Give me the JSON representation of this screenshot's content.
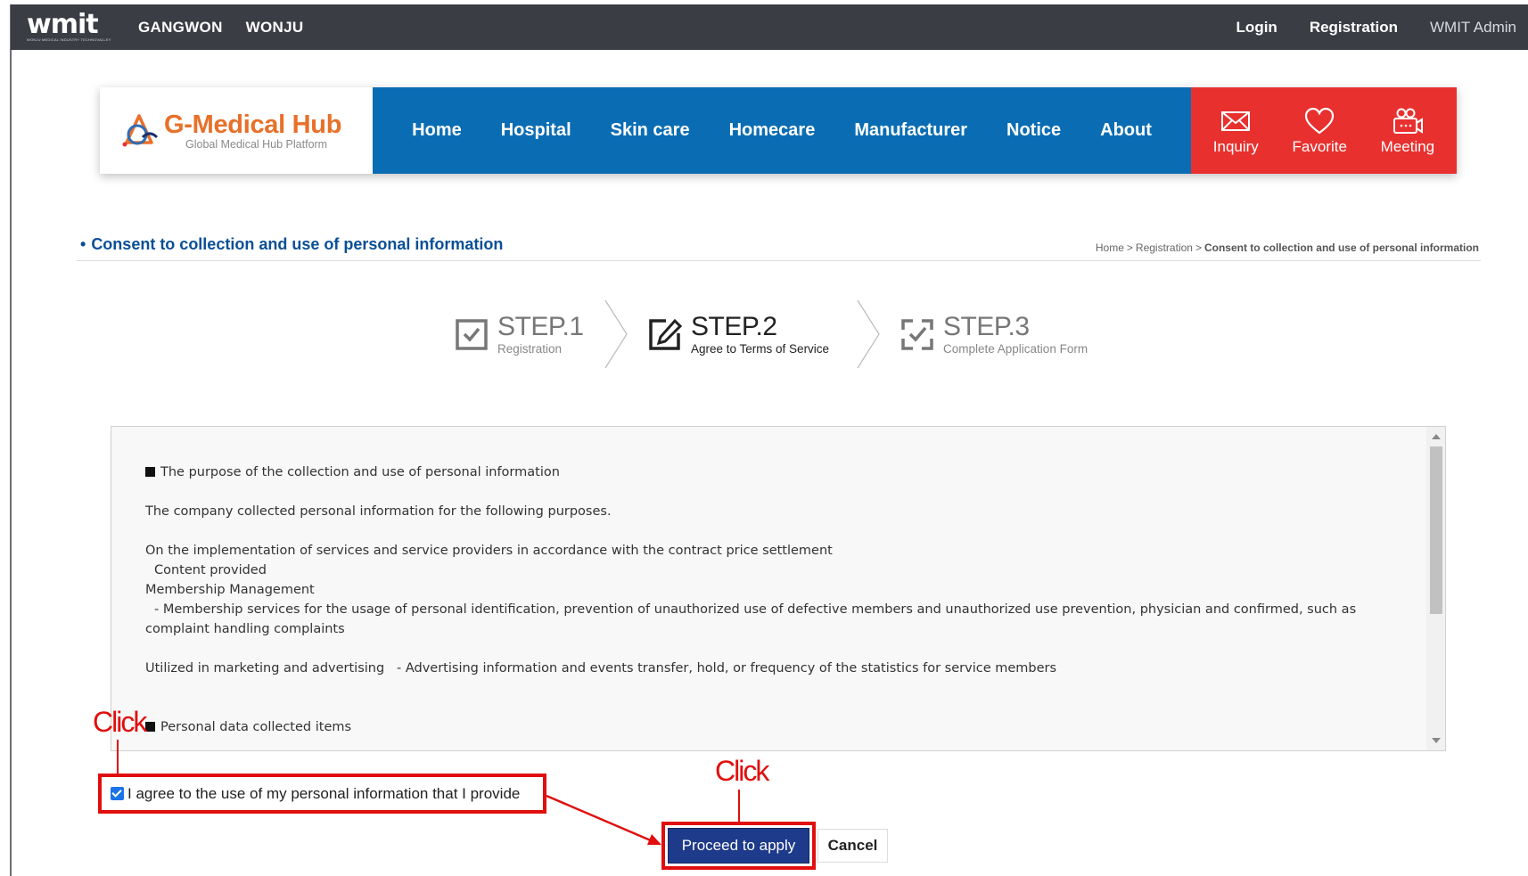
{
  "topbar": {
    "logo_word": "wmit",
    "logo_tag": "WONJU MEDICAL INDUSTRY TECHNOVALLEY",
    "regions": [
      "GANGWON",
      "WONJU"
    ],
    "links": [
      "Login",
      "Registration"
    ],
    "admin": "WMIT Admin"
  },
  "header": {
    "brand_name": "G-Medical Hub",
    "brand_sub": "Global Medical Hub Platform",
    "menu": [
      "Home",
      "Hospital",
      "Skin care",
      "Homecare",
      "Manufacturer",
      "Notice",
      "About"
    ],
    "actions": [
      {
        "label": "Inquiry",
        "icon": "mail-icon"
      },
      {
        "label": "Favorite",
        "icon": "heart-icon"
      },
      {
        "label": "Meeting",
        "icon": "video-meeting-icon"
      }
    ],
    "colors": {
      "menu_bg": "#0a6db4",
      "actions_bg": "#e8312f",
      "brand": "#e8702a"
    }
  },
  "page": {
    "bullet": "•",
    "title": "Consent to collection and use of personal information",
    "breadcrumb": [
      "Home",
      "Registration",
      "Consent to collection and use of personal information"
    ],
    "breadcrumb_sep": ">"
  },
  "steps": [
    {
      "big": "STEP.1",
      "small": "Registration",
      "icon": "checkbox-icon",
      "state": "done"
    },
    {
      "big": "STEP.2",
      "small": "Agree to Terms of Service",
      "icon": "edit-icon",
      "state": "active"
    },
    {
      "big": "STEP.3",
      "small": "Complete Application Form",
      "icon": "checklist-icon",
      "state": "pending"
    }
  ],
  "terms": {
    "heading1": "The purpose of the collection and use of personal information",
    "line1": "The company collected personal information for the following purposes.",
    "line2": "On the implementation of services and service providers in accordance with the contract price settlement",
    "line3": "Content provided",
    "line4": "Membership Management",
    "line5": "- Membership services for the usage of personal identification, prevention of unauthorized use of defective members and unauthorized use prevention, physician and confirmed, such as complaint handling complaints",
    "line6": "Utilized in marketing and advertising   - Advertising information and events transfer, hold, or frequency of the statistics for service members",
    "heading2": "Personal data collected items"
  },
  "agree": {
    "label": "I agree to the use of my personal information that I provide",
    "checked": true
  },
  "buttons": {
    "proceed": "Proceed to apply",
    "cancel": "Cancel"
  },
  "annotations": {
    "click1": "Click",
    "click2": "Click",
    "color": "#e10e0e"
  }
}
